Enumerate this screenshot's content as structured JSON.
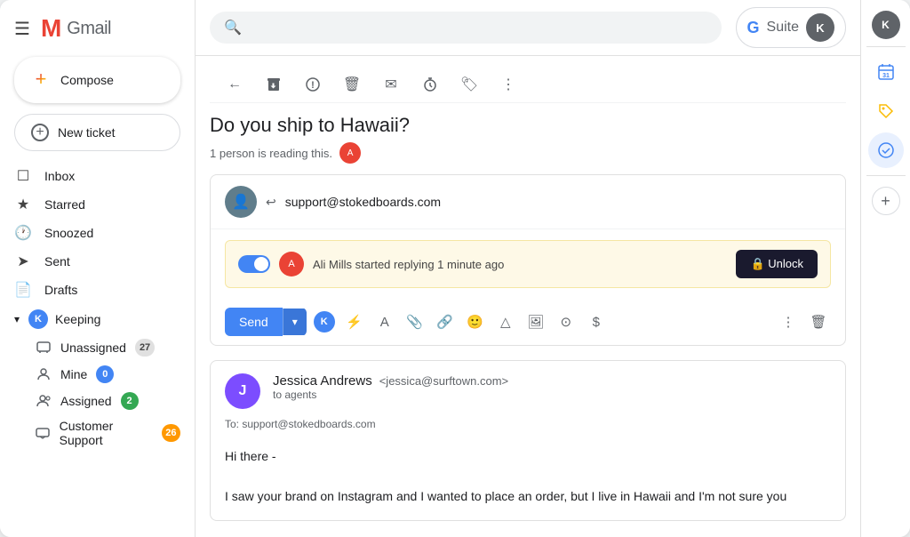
{
  "header": {
    "title": "Gmail",
    "search_placeholder": "",
    "gsuite_label": "Suite",
    "avatar_initials": "K"
  },
  "sidebar": {
    "compose_label": "Compose",
    "new_ticket_label": "New ticket",
    "nav_items": [
      {
        "id": "inbox",
        "label": "Inbox",
        "icon": "☐"
      },
      {
        "id": "starred",
        "label": "Starred",
        "icon": "★"
      },
      {
        "id": "snoozed",
        "label": "Snoozed",
        "icon": "🕐"
      },
      {
        "id": "sent",
        "label": "Sent",
        "icon": "➤"
      },
      {
        "id": "drafts",
        "label": "Drafts",
        "icon": "📄"
      }
    ],
    "keeping_section": {
      "label": "Keeping",
      "icon_letter": "K"
    },
    "sub_items": [
      {
        "id": "unassigned",
        "label": "Unassigned",
        "badge": "27",
        "badge_type": "gray"
      },
      {
        "id": "mine",
        "label": "Mine",
        "badge": "0",
        "badge_type": "blue"
      },
      {
        "id": "assigned",
        "label": "Assigned",
        "badge": "2",
        "badge_type": "green"
      },
      {
        "id": "customer-support",
        "label": "Customer Support",
        "badge": "26",
        "badge_type": "orange"
      }
    ]
  },
  "email_view": {
    "subject": "Do you ship to Hawaii?",
    "reading_notice": "1 person is reading this.",
    "action_bar": {
      "back": "←",
      "archive": "⬇",
      "spam": "!",
      "delete": "🗑",
      "mark_read": "✉",
      "snooze": "⬇",
      "label": "🏷",
      "more": "⋮"
    },
    "reply_card": {
      "from": "support@stokedboards.com",
      "replying_text": "Ali Mills started replying 1 minute ago",
      "unlock_label": "🔒 Unlock"
    },
    "send_btn": "Send",
    "message": {
      "sender_name": "Jessica Andrews",
      "sender_email": "<jessica@surftown.com>",
      "to_label": "to agents",
      "to_address": "To: support@stokedboards.com",
      "body_line1": "Hi there -",
      "body_line2": "I saw your brand on Instagram and I wanted to place an order, but I live in Hawaii and I'm not sure you"
    }
  },
  "right_sidebar": {
    "avatar_initials": "K",
    "icons": [
      "calendar",
      "tag",
      "checkmark",
      "plus"
    ]
  }
}
